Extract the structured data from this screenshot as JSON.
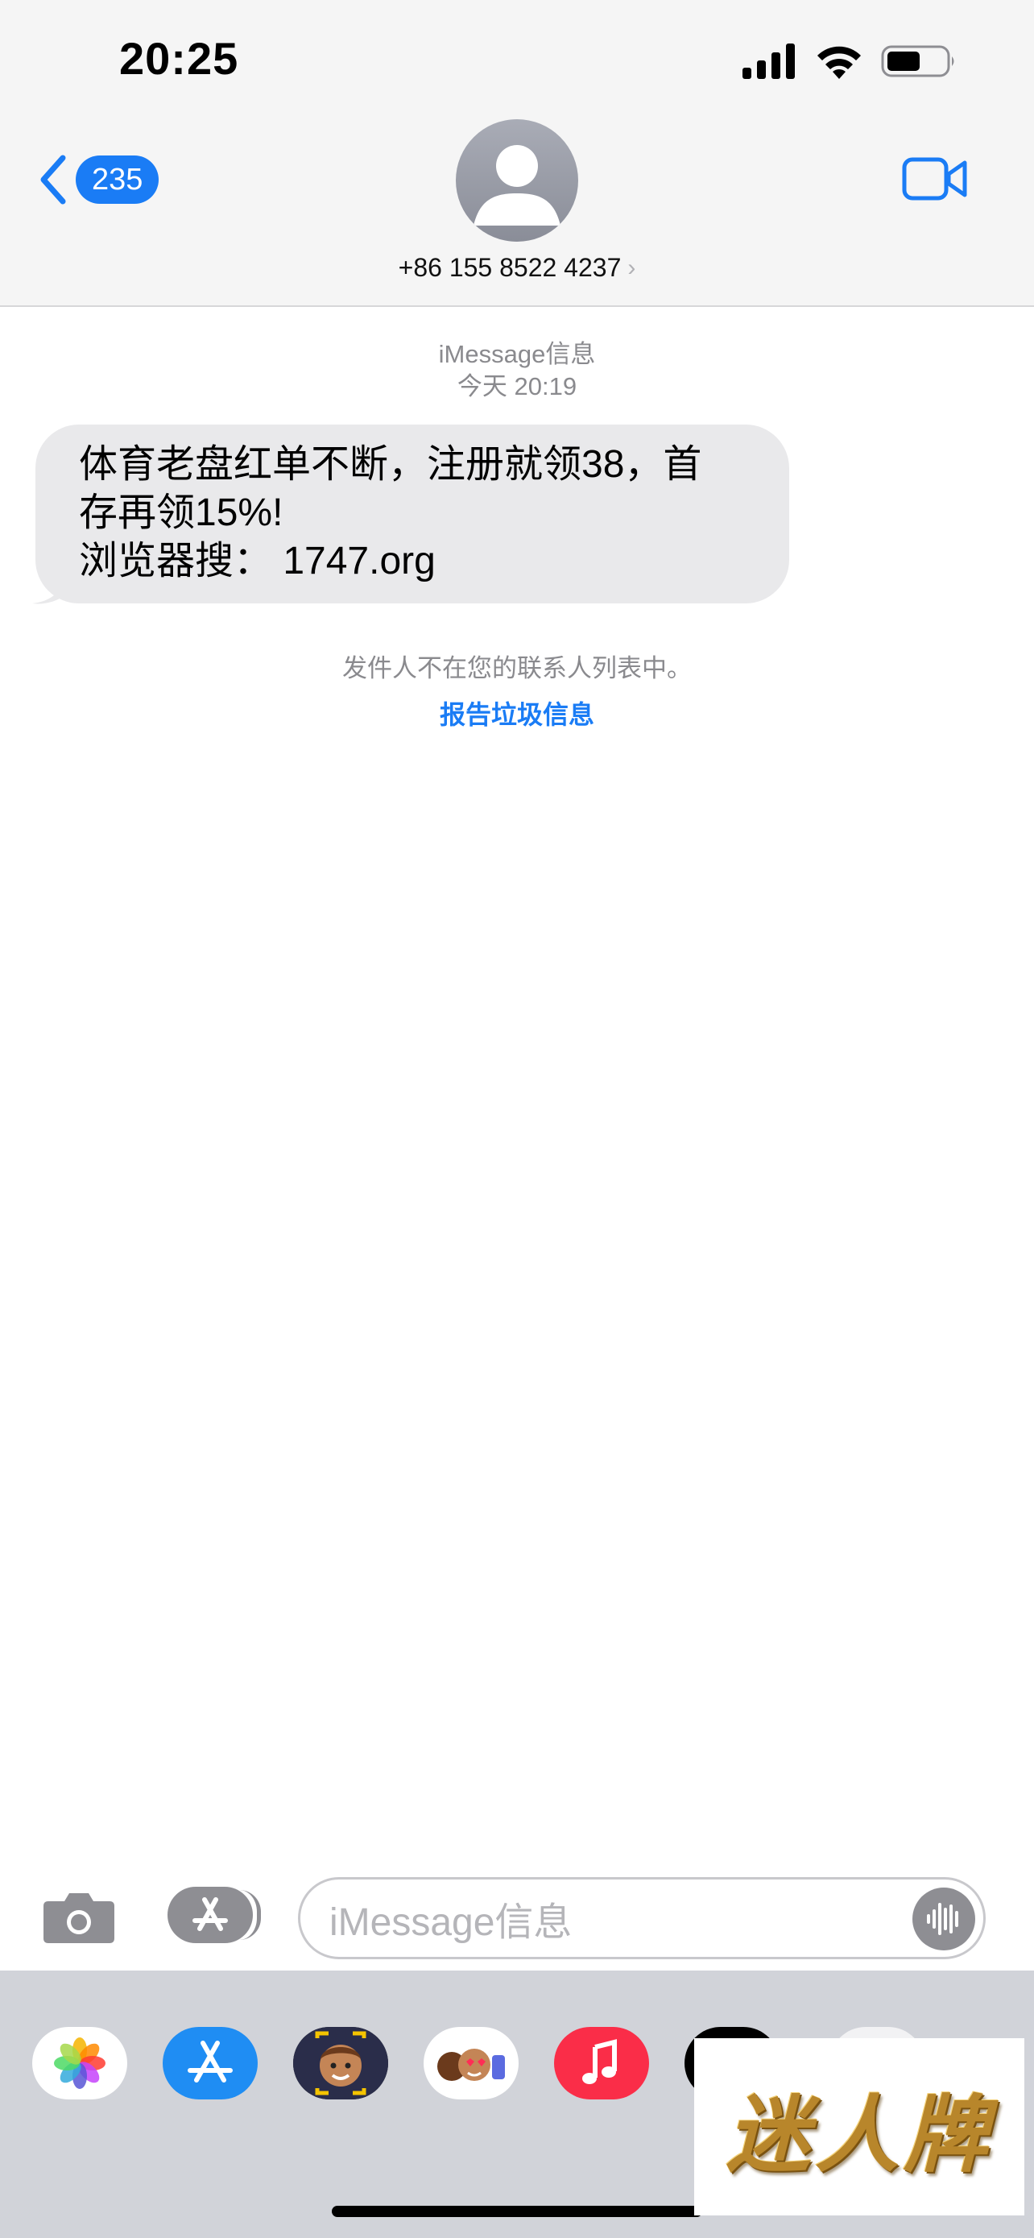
{
  "status_bar": {
    "time": "20:25",
    "icons": [
      "cellular-signal-icon",
      "wifi-icon",
      "battery-icon"
    ]
  },
  "header": {
    "back_count": "235",
    "contact_number": "+86 155 8522 4237",
    "contact_chevron": "›",
    "video_icon": "video-camera-icon"
  },
  "conversation": {
    "service_label": "iMessage信息",
    "timestamp": "今天 20:19",
    "message": {
      "line1": "体育老盘红单不断，注册就领38，首",
      "line2": "存再领15%!",
      "line3": "浏览器搜： 1747.org"
    },
    "unknown_sender_notice": "发件人不在您的联系人列表中。",
    "report_junk_label": "报告垃圾信息"
  },
  "input_bar": {
    "placeholder": "iMessage信息",
    "icons": [
      "camera-icon",
      "app-store-icon",
      "audio-waveform-icon"
    ]
  },
  "app_drawer": {
    "apps": [
      "photos-app-icon",
      "app-store-app-icon",
      "memoji-app-icon",
      "animoji-stickers-app-icon",
      "music-app-icon",
      "dark-app-icon",
      "more-app-icon"
    ]
  },
  "watermark": {
    "text": "迷人牌"
  },
  "colors": {
    "accent": "#1a7cf5",
    "bubble_gray": "#e9e9eb",
    "header_bg": "#f5f5f5",
    "drawer_bg": "#d1d3d9",
    "secondary_text": "#8a8a8e"
  }
}
